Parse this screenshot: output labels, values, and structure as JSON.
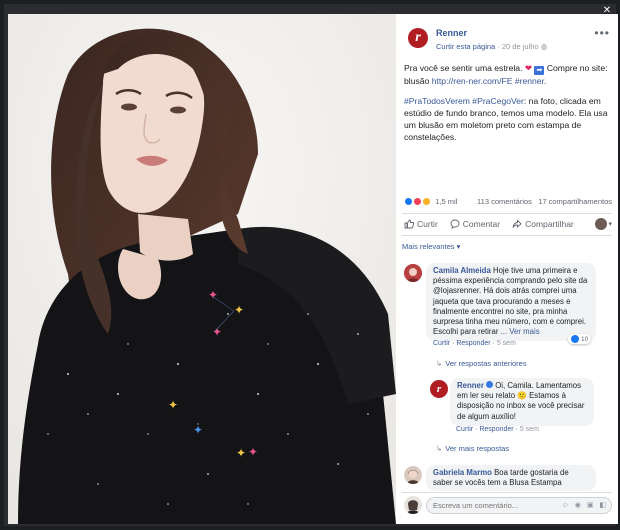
{
  "window": {
    "close_glyph": "✕"
  },
  "post": {
    "page_name": "Renner",
    "logo_letter": "r",
    "follow_label": "Curtir esta página",
    "date": "20 de julho",
    "meta_sep": "·",
    "more_glyph": "•••",
    "text1_pre": "Pra você se sentir uma estrela. ",
    "text1_heart": "❤",
    "text1_arrow": "➡",
    "text1_mid": " Compre no site: blusão ",
    "text1_link": "http://ren-ner.com/FE",
    "text1_hashtag": " #renner",
    "text1_end": ".",
    "text2_hashtags": "#PraTodosVerem #PraCegoVer",
    "text2_rest": ": na foto, clicada em estúdio de fundo branco, temos uma modelo. Ela usa um blusão em moletom preto com estampa de constelações."
  },
  "stats": {
    "reactions_count": "1,5 mil",
    "comments": "113 comentários",
    "shares": "17 compartilhamentos"
  },
  "actions": {
    "like": "Curtir",
    "comment": "Comentar",
    "share": "Compartilhar"
  },
  "sort_label": "Mais relevantes ▾",
  "comments": [
    {
      "name": "Camila Almeida",
      "text": "Hoje tive uma primeira e péssima experiência comprando pelo site da @lojasrenner. Há dois atrás comprei uma jaqueta que tava procurando a meses e finalmente encontrei no site, pra minha surpresa tinha meu número, com e comprei. Escolhi para retirar",
      "see_more": "... Ver mais",
      "like_action": "Curtir",
      "reply_action": "Responder",
      "time": "5 sem",
      "likes": "10",
      "view_replies": "Ver respostas anteriores"
    },
    {
      "name": "Renner",
      "text": "Oi, Camila. Lamentamos em ler seu relato 🙁 Estamos à disposição no inbox se você precisar de algum auxílio!",
      "like_action": "Curtir",
      "reply_action": "Responder",
      "time": "5 sem",
      "view_replies": "Ver mais respostas"
    },
    {
      "name": "Gabriela Marmo",
      "text": "Boa tarde gostaria de saber se vocês tem a Blusa Estampa"
    }
  ],
  "write": {
    "placeholder": "Escreva um comentário...",
    "icons": "☺ ◉ ▣ ◧"
  },
  "colors": {
    "link": "#385898",
    "brand": "#b01e23",
    "like_blue": "#1877f2"
  }
}
